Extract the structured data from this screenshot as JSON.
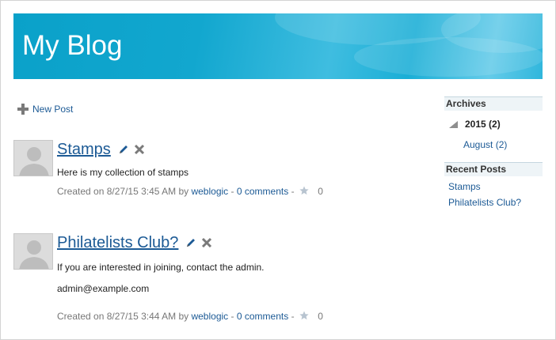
{
  "header": {
    "title": "My Blog"
  },
  "toolbar": {
    "new_post_label": "New Post"
  },
  "posts": [
    {
      "title": "Stamps",
      "body": [
        "Here is my collection of stamps"
      ],
      "created_prefix": "Created on 8/27/15 3:45 AM by",
      "author": "weblogic",
      "comments": "0 comments",
      "likes": "0"
    },
    {
      "title": "Philatelists Club?",
      "body": [
        "If you are interested in joining, contact the admin.",
        "admin@example.com"
      ],
      "created_prefix": "Created on 8/27/15 3:44 AM by",
      "author": "weblogic",
      "comments": "0 comments",
      "likes": "0"
    }
  ],
  "sidebar": {
    "archives_heading": "Archives",
    "year_label": "2015 (2)",
    "month_label": "August (2)",
    "recent_heading": "Recent Posts",
    "recent_posts": [
      "Stamps",
      "Philatelists Club?"
    ]
  },
  "colors": {
    "banner": "#12a7cf",
    "link": "#1c5a95"
  }
}
